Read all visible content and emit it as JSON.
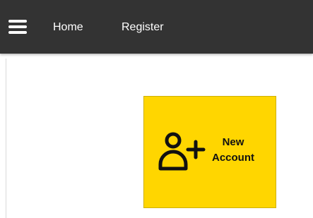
{
  "navbar": {
    "menu_icon": "hamburger-menu-icon",
    "links": [
      {
        "label": "Home"
      },
      {
        "label": "Register"
      }
    ]
  },
  "tile": {
    "icon": "add-user-icon",
    "label_line1": "New",
    "label_line2": "Account",
    "background_color": "#ffd600"
  },
  "colors": {
    "navbar_bg": "#333333",
    "nav_text": "#ffffff",
    "page_bg": "#ffffff"
  }
}
